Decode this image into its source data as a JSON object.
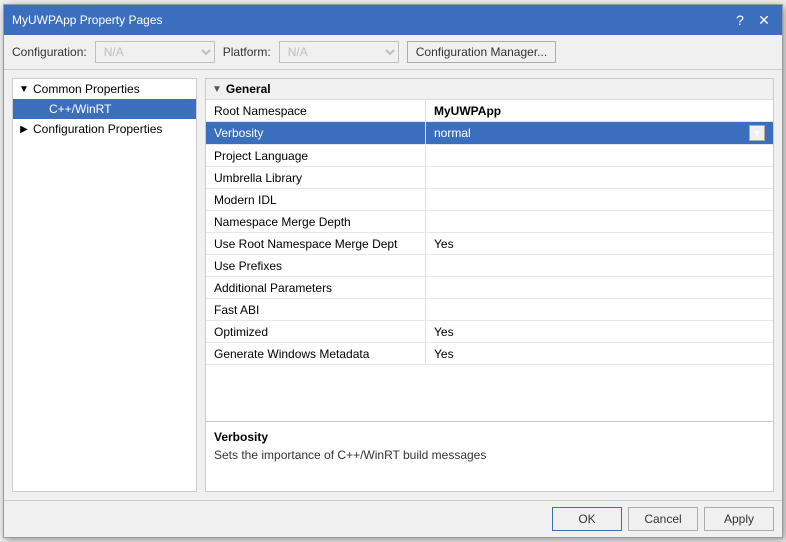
{
  "titleBar": {
    "title": "MyUWPApp Property Pages",
    "helpButton": "?",
    "closeButton": "✕"
  },
  "toolbar": {
    "configLabel": "Configuration:",
    "configValue": "N/A",
    "platformLabel": "Platform:",
    "platformValue": "N/A",
    "configManagerBtn": "Configuration Manager..."
  },
  "sidebar": {
    "items": [
      {
        "id": "common-properties",
        "label": "Common Properties",
        "level": 0,
        "arrow": "▼",
        "selected": false
      },
      {
        "id": "cpp-winrt",
        "label": "C++/WinRT",
        "level": 1,
        "arrow": "",
        "selected": true
      },
      {
        "id": "configuration-properties",
        "label": "Configuration Properties",
        "level": 0,
        "arrow": "▶",
        "selected": false
      }
    ]
  },
  "propertyGrid": {
    "sectionLabel": "General",
    "properties": [
      {
        "id": "root-namespace",
        "name": "Root Namespace",
        "value": "MyUWPApp",
        "valueBold": true,
        "selected": false
      },
      {
        "id": "verbosity",
        "name": "Verbosity",
        "value": "normal",
        "valueBold": false,
        "hasDropdown": true,
        "selected": true
      },
      {
        "id": "project-language",
        "name": "Project Language",
        "value": "",
        "valueBold": false,
        "selected": false
      },
      {
        "id": "umbrella-library",
        "name": "Umbrella Library",
        "value": "",
        "valueBold": false,
        "selected": false
      },
      {
        "id": "modern-idl",
        "name": "Modern IDL",
        "value": "",
        "valueBold": false,
        "selected": false
      },
      {
        "id": "namespace-merge-depth",
        "name": "Namespace Merge Depth",
        "value": "",
        "valueBold": false,
        "selected": false
      },
      {
        "id": "use-root-namespace-merge-depth",
        "name": "Use Root Namespace Merge Dept",
        "value": "Yes",
        "valueBold": false,
        "selected": false
      },
      {
        "id": "use-prefixes",
        "name": "Use Prefixes",
        "value": "",
        "valueBold": false,
        "selected": false
      },
      {
        "id": "additional-parameters",
        "name": "Additional Parameters",
        "value": "",
        "valueBold": false,
        "selected": false
      },
      {
        "id": "fast-abi",
        "name": "Fast ABI",
        "value": "",
        "valueBold": false,
        "selected": false
      },
      {
        "id": "optimized",
        "name": "Optimized",
        "value": "Yes",
        "valueBold": false,
        "selected": false
      },
      {
        "id": "generate-windows-metadata",
        "name": "Generate Windows Metadata",
        "value": "Yes",
        "valueBold": false,
        "selected": false
      }
    ]
  },
  "description": {
    "title": "Verbosity",
    "text": "Sets the importance of C++/WinRT build messages"
  },
  "footer": {
    "okLabel": "OK",
    "cancelLabel": "Cancel",
    "applyLabel": "Apply"
  }
}
